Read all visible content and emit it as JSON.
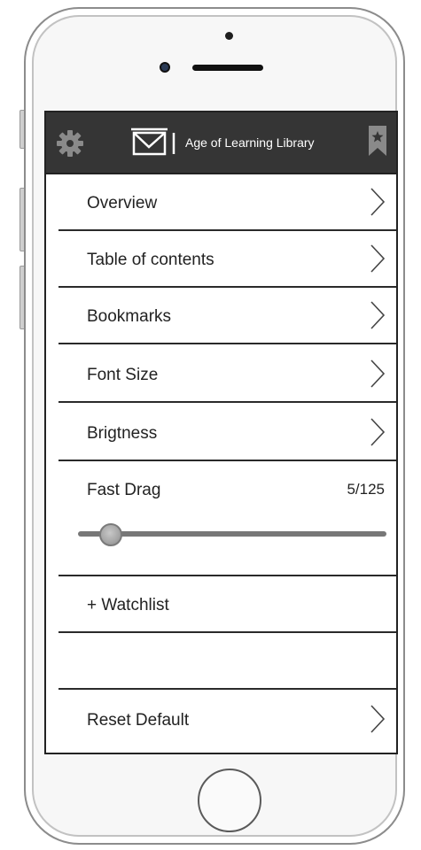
{
  "header": {
    "title": "Age of Learning Library",
    "left_icon": "gear-icon",
    "logo_icon": "book-logo-icon",
    "right_icon": "bookmark-star-icon"
  },
  "menu": {
    "items": [
      {
        "label": "Overview",
        "icon": "chevron-right-icon"
      },
      {
        "label": "Table of contents",
        "icon": "chevron-right-icon"
      },
      {
        "label": "Bookmarks",
        "icon": "chevron-right-icon"
      },
      {
        "label": "Font Size",
        "icon": "chevron-right-icon"
      },
      {
        "label": "Brigtness",
        "icon": "chevron-right-icon"
      }
    ]
  },
  "fast_drag": {
    "label": "Fast Drag",
    "counter": "5/125",
    "position": 5,
    "total": 125
  },
  "watchlist": {
    "label": "+ Watchlist"
  },
  "reset": {
    "label": "Reset Default",
    "icon": "chevron-right-icon"
  },
  "colors": {
    "header_bg": "#353535",
    "header_text": "#ffffff",
    "divider": "#2a2a2a"
  }
}
